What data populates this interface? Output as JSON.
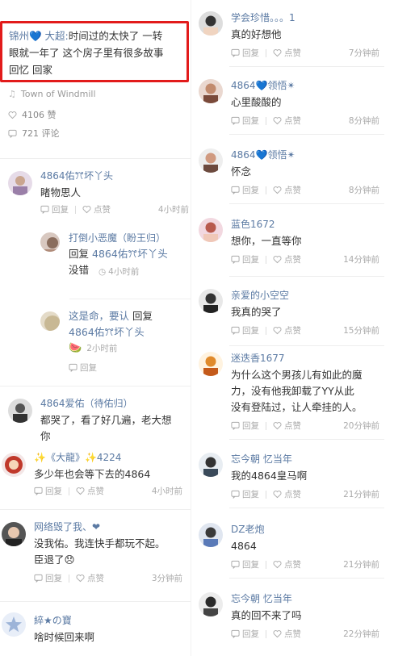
{
  "post": {
    "author": "锦州💙 大超:",
    "text_line1": "时间过的太快了 一转",
    "text_line2": "眼就一年了 这个房子里有很多故事",
    "text_line3": "回忆 回家",
    "music": "Town of Windmill",
    "likes": "4106 赞",
    "comments": "721 评论"
  },
  "actions": {
    "reply": "回复",
    "like": "点赞"
  },
  "left_comments": [
    {
      "name": "4864佑ꔫ坏丫头",
      "text": "睹物思人",
      "time": "4小时前"
    },
    {
      "name": "4864爱佑（待佑归）",
      "text1": "都哭了，看了好几遍，老大想",
      "text2": "你"
    },
    {
      "name": "✨《大龍》✨4224",
      "text": "多少年也会等下去的4864",
      "time": "4小时前"
    },
    {
      "name": "网络毁了我、❤",
      "text1": "没我佑。我连快手都玩不起。",
      "text2": "臣退了😞",
      "time": "3分钟前"
    },
    {
      "name": "綷★の寶",
      "text": "啥时候回来啊"
    }
  ],
  "left_replies": [
    {
      "name": "打倒小恶魔（盼王归）",
      "reply_word": "回复",
      "target": "4864佑ꔫ坏丫头",
      "text": "没错",
      "time": "4小时前"
    },
    {
      "name": "这是命，要认",
      "reply_word": "回复",
      "target": "4864佑ꔫ坏丫头",
      "emoji": "🍉",
      "time": "2小时前"
    }
  ],
  "right_comments": [
    {
      "name": "学会珍惜。。。1",
      "text": "真的好想他",
      "time": "7分钟前"
    },
    {
      "name": "4864💙领悟✴",
      "text": "心里酸酸的",
      "time": "8分钟前"
    },
    {
      "name": "4864💙领悟✴",
      "text": "怀念",
      "time": "8分钟前"
    },
    {
      "name": "蓝色1672",
      "text": "想你，一直等你",
      "time": "14分钟前"
    },
    {
      "name": "亲爱的小空空",
      "text": "我真的哭了",
      "time": "15分钟前"
    },
    {
      "name": "迷迭香1677",
      "text1": "为什么这个男孩儿有如此的魔",
      "text2": "力，没有他我卸载了YY从此",
      "text3": "没有登陆过，让人牵挂的人。",
      "time": "20分钟前"
    },
    {
      "name": "忘今朝 忆当年",
      "text": "我的4864皇马啊",
      "time": "21分钟前"
    },
    {
      "name": "DZ老炮",
      "text": "4864",
      "time": "21分钟前"
    },
    {
      "name": "忘今朝 忆当年",
      "text": "真的回不来了吗",
      "time": "22分钟前"
    }
  ],
  "colors": {
    "highlight": "#e02020",
    "name": "#5b7aa3",
    "muted": "#aaaaaa"
  }
}
